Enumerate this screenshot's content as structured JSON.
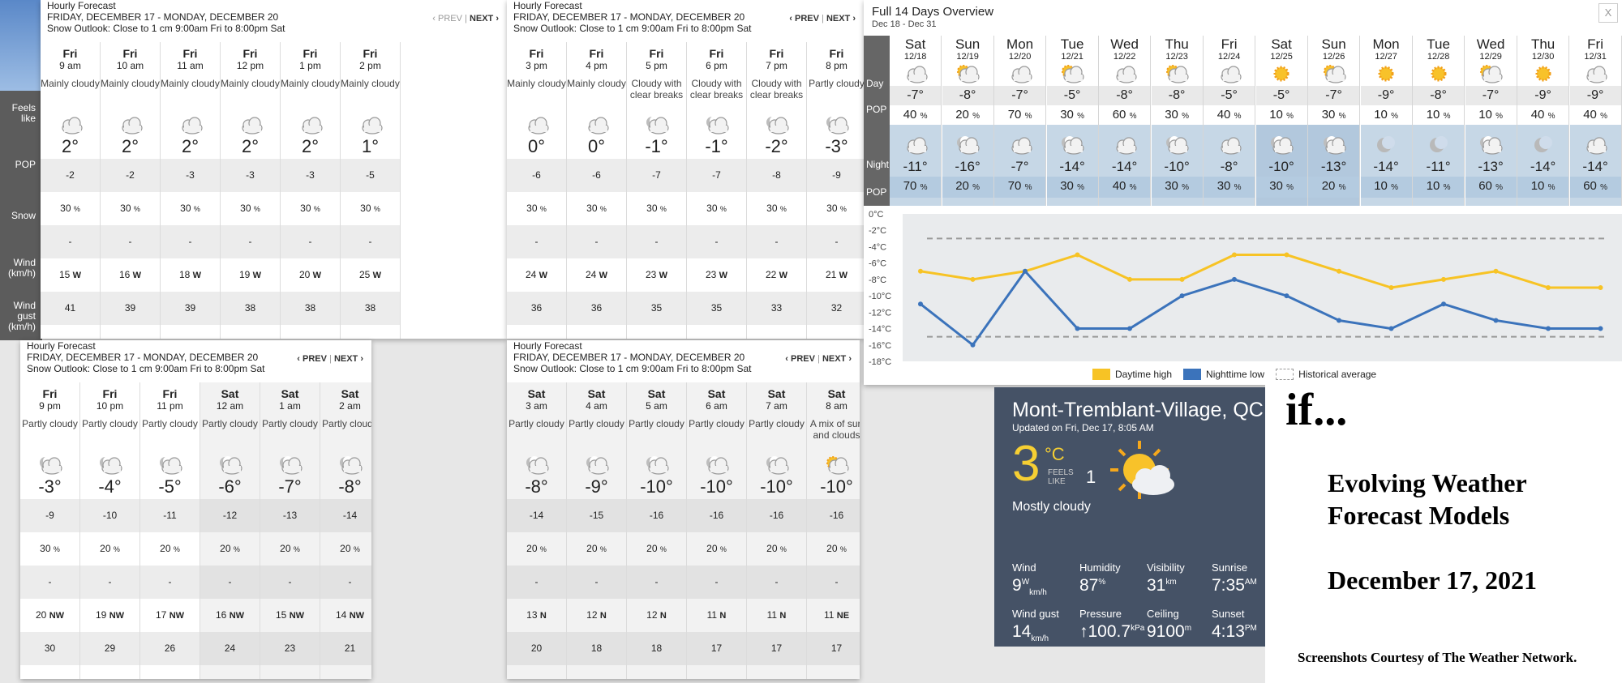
{
  "left_labels": [
    "Feels like",
    "POP",
    "Snow",
    "Wind (km/h)",
    "Wind gust (km/h)"
  ],
  "panels": [
    {
      "heading": "Hourly Forecast",
      "range": "FRIDAY, DECEMBER 17 - MONDAY, DECEMBER 20",
      "outlook": "Snow Outlook: Close to 1 cm 9:00am Fri to 8:00pm Sat",
      "prev": "‹ PREV",
      "sep": "|",
      "next": "NEXT ›",
      "prev_enabled": false,
      "cols": [
        {
          "day": "Fri",
          "time": "9 am",
          "cond": "Mainly cloudy",
          "icon": "cloudy-icon",
          "temp": "2°",
          "feels": "-2",
          "pop": "30",
          "snow": "-",
          "wind": "15",
          "dir": "W",
          "gust": "41",
          "shade": false
        },
        {
          "day": "Fri",
          "time": "10 am",
          "cond": "Mainly cloudy",
          "icon": "cloudy-icon",
          "temp": "2°",
          "feels": "-2",
          "pop": "30",
          "snow": "-",
          "wind": "16",
          "dir": "W",
          "gust": "39",
          "shade": false
        },
        {
          "day": "Fri",
          "time": "11 am",
          "cond": "Mainly cloudy",
          "icon": "cloudy-icon",
          "temp": "2°",
          "feels": "-3",
          "pop": "30",
          "snow": "-",
          "wind": "18",
          "dir": "W",
          "gust": "39",
          "shade": false
        },
        {
          "day": "Fri",
          "time": "12 pm",
          "cond": "Mainly cloudy",
          "icon": "cloudy-icon",
          "temp": "2°",
          "feels": "-3",
          "pop": "30",
          "snow": "-",
          "wind": "19",
          "dir": "W",
          "gust": "38",
          "shade": false
        },
        {
          "day": "Fri",
          "time": "1 pm",
          "cond": "Mainly cloudy",
          "icon": "cloudy-icon",
          "temp": "2°",
          "feels": "-3",
          "pop": "30",
          "snow": "-",
          "wind": "20",
          "dir": "W",
          "gust": "38",
          "shade": false
        },
        {
          "day": "Fri",
          "time": "2 pm",
          "cond": "Mainly cloudy",
          "icon": "cloudy-icon",
          "temp": "1°",
          "feels": "-5",
          "pop": "30",
          "snow": "-",
          "wind": "25",
          "dir": "W",
          "gust": "38",
          "shade": false
        }
      ]
    },
    {
      "heading": "Hourly Forecast",
      "range": "FRIDAY, DECEMBER 17 - MONDAY, DECEMBER 20",
      "outlook": "Snow Outlook: Close to 1 cm 9:00am Fri to 8:00pm Sat",
      "prev": "‹ PREV",
      "sep": "|",
      "next": "NEXT ›",
      "prev_enabled": true,
      "cols": [
        {
          "day": "Fri",
          "time": "3 pm",
          "cond": "Mainly cloudy",
          "icon": "cloudy-icon",
          "temp": "0°",
          "feels": "-6",
          "pop": "30",
          "snow": "-",
          "wind": "24",
          "dir": "W",
          "gust": "36",
          "shade": false
        },
        {
          "day": "Fri",
          "time": "4 pm",
          "cond": "Mainly cloudy",
          "icon": "cloudy-icon",
          "temp": "0°",
          "feels": "-6",
          "pop": "30",
          "snow": "-",
          "wind": "24",
          "dir": "W",
          "gust": "36",
          "shade": false
        },
        {
          "day": "Fri",
          "time": "5 pm",
          "cond": "Cloudy with clear breaks",
          "icon": "cloud-moon-icon",
          "temp": "-1°",
          "feels": "-7",
          "pop": "30",
          "snow": "-",
          "wind": "23",
          "dir": "W",
          "gust": "35",
          "shade": false
        },
        {
          "day": "Fri",
          "time": "6 pm",
          "cond": "Cloudy with clear breaks",
          "icon": "cloud-moon-icon",
          "temp": "-1°",
          "feels": "-7",
          "pop": "30",
          "snow": "-",
          "wind": "23",
          "dir": "W",
          "gust": "35",
          "shade": false
        },
        {
          "day": "Fri",
          "time": "7 pm",
          "cond": "Cloudy with clear breaks",
          "icon": "cloud-moon-icon",
          "temp": "-2°",
          "feels": "-8",
          "pop": "30",
          "snow": "-",
          "wind": "22",
          "dir": "W",
          "gust": "33",
          "shade": false
        },
        {
          "day": "Fri",
          "time": "8 pm",
          "cond": "Partly cloudy",
          "icon": "cloud-moon-icon",
          "temp": "-3°",
          "feels": "-9",
          "pop": "30",
          "snow": "-",
          "wind": "21",
          "dir": "W",
          "gust": "32",
          "shade": false
        }
      ]
    },
    {
      "heading": "Hourly Forecast",
      "range": "FRIDAY, DECEMBER 17 - MONDAY, DECEMBER 20",
      "outlook": "Snow Outlook: Close to 1 cm 9:00am Fri to 8:00pm Sat",
      "prev": "‹ PREV",
      "sep": "|",
      "next": "NEXT ›",
      "prev_enabled": true,
      "cols": [
        {
          "day": "Fri",
          "time": "9 pm",
          "cond": "Partly cloudy",
          "icon": "cloud-moon-icon",
          "temp": "-3°",
          "feels": "-9",
          "pop": "30",
          "snow": "-",
          "wind": "20",
          "dir": "NW",
          "gust": "30",
          "shade": false
        },
        {
          "day": "Fri",
          "time": "10 pm",
          "cond": "Partly cloudy",
          "icon": "cloud-moon-icon",
          "temp": "-4°",
          "feels": "-10",
          "pop": "20",
          "snow": "-",
          "wind": "19",
          "dir": "NW",
          "gust": "29",
          "shade": false
        },
        {
          "day": "Fri",
          "time": "11 pm",
          "cond": "Partly cloudy",
          "icon": "cloud-moon-icon",
          "temp": "-5°",
          "feels": "-11",
          "pop": "20",
          "snow": "-",
          "wind": "17",
          "dir": "NW",
          "gust": "26",
          "shade": false
        },
        {
          "day": "Sat",
          "time": "12 am",
          "cond": "Partly cloudy",
          "icon": "cloud-moon-icon",
          "temp": "-6°",
          "feels": "-12",
          "pop": "20",
          "snow": "-",
          "wind": "16",
          "dir": "NW",
          "gust": "24",
          "shade": true
        },
        {
          "day": "Sat",
          "time": "1 am",
          "cond": "Partly cloudy",
          "icon": "cloud-moon-icon",
          "temp": "-7°",
          "feels": "-13",
          "pop": "20",
          "snow": "-",
          "wind": "15",
          "dir": "NW",
          "gust": "23",
          "shade": true
        },
        {
          "day": "Sat",
          "time": "2 am",
          "cond": "Partly cloudy",
          "icon": "cloud-moon-icon",
          "temp": "-8°",
          "feels": "-14",
          "pop": "20",
          "snow": "-",
          "wind": "14",
          "dir": "NW",
          "gust": "21",
          "shade": true
        }
      ]
    },
    {
      "heading": "Hourly Forecast",
      "range": "FRIDAY, DECEMBER 17 - MONDAY, DECEMBER 20",
      "outlook": "Snow Outlook: Close to 1 cm 9:00am Fri to 8:00pm Sat",
      "prev": "‹ PREV",
      "sep": "|",
      "next": "NEXT ›",
      "prev_enabled": true,
      "cols": [
        {
          "day": "Sat",
          "time": "3 am",
          "cond": "Partly cloudy",
          "icon": "cloud-moon-icon",
          "temp": "-8°",
          "feels": "-14",
          "pop": "20",
          "snow": "-",
          "wind": "13",
          "dir": "N",
          "gust": "20",
          "shade": true
        },
        {
          "day": "Sat",
          "time": "4 am",
          "cond": "Partly cloudy",
          "icon": "cloud-moon-icon",
          "temp": "-9°",
          "feels": "-15",
          "pop": "20",
          "snow": "-",
          "wind": "12",
          "dir": "N",
          "gust": "18",
          "shade": true
        },
        {
          "day": "Sat",
          "time": "5 am",
          "cond": "Partly cloudy",
          "icon": "cloud-moon-icon",
          "temp": "-10°",
          "feels": "-16",
          "pop": "20",
          "snow": "-",
          "wind": "12",
          "dir": "N",
          "gust": "18",
          "shade": true
        },
        {
          "day": "Sat",
          "time": "6 am",
          "cond": "Partly cloudy",
          "icon": "cloud-moon-icon",
          "temp": "-10°",
          "feels": "-16",
          "pop": "20",
          "snow": "-",
          "wind": "11",
          "dir": "N",
          "gust": "17",
          "shade": true
        },
        {
          "day": "Sat",
          "time": "7 am",
          "cond": "Partly cloudy",
          "icon": "cloud-moon-icon",
          "temp": "-10°",
          "feels": "-16",
          "pop": "20",
          "snow": "-",
          "wind": "11",
          "dir": "N",
          "gust": "17",
          "shade": true
        },
        {
          "day": "Sat",
          "time": "8 am",
          "cond": "A mix of sun and clouds",
          "icon": "sun-cloud-icon",
          "temp": "-10°",
          "feels": "-16",
          "pop": "20",
          "snow": "-",
          "wind": "11",
          "dir": "NE",
          "gust": "17",
          "shade": true
        }
      ]
    }
  ],
  "overview": {
    "title": "Full 14 Days Overview",
    "dates": "Dec 18 - Dec 31",
    "close": "X",
    "labels": {
      "day": "Day",
      "pop": "POP",
      "night": "Night"
    },
    "days": [
      {
        "dn": "Sat",
        "dd": "12/18",
        "di": "cloudy-icon",
        "dt": "-7°",
        "dp": "40",
        "ni": "cloudy-icon",
        "nt": "-11°",
        "np": "70"
      },
      {
        "dn": "Sun",
        "dd": "12/19",
        "di": "sun-cloud-icon",
        "dt": "-8°",
        "dp": "20",
        "ni": "cloud-moon-icon",
        "nt": "-16°",
        "np": "20"
      },
      {
        "dn": "Mon",
        "dd": "12/20",
        "di": "cloudy-icon",
        "dt": "-7°",
        "dp": "70",
        "ni": "cloudy-icon",
        "nt": "-7°",
        "np": "70"
      },
      {
        "dn": "Tue",
        "dd": "12/21",
        "di": "sun-cloud-icon",
        "dt": "-5°",
        "dp": "30",
        "ni": "cloud-moon-icon",
        "nt": "-14°",
        "np": "30"
      },
      {
        "dn": "Wed",
        "dd": "12/22",
        "di": "cloudy-icon",
        "dt": "-8°",
        "dp": "60",
        "ni": "cloudy-icon",
        "nt": "-14°",
        "np": "40"
      },
      {
        "dn": "Thu",
        "dd": "12/23",
        "di": "sun-cloud-icon",
        "dt": "-8°",
        "dp": "30",
        "ni": "cloud-moon-icon",
        "nt": "-10°",
        "np": "30"
      },
      {
        "dn": "Fri",
        "dd": "12/24",
        "di": "cloudy-icon",
        "dt": "-5°",
        "dp": "40",
        "ni": "cloudy-icon",
        "nt": "-8°",
        "np": "30"
      },
      {
        "dn": "Sat",
        "dd": "12/25",
        "di": "sun-icon",
        "dt": "-5°",
        "dp": "10",
        "ni": "cloud-moon-icon",
        "nt": "-10°",
        "np": "30"
      },
      {
        "dn": "Sun",
        "dd": "12/26",
        "di": "sun-cloud-icon",
        "dt": "-7°",
        "dp": "30",
        "ni": "cloud-moon-icon",
        "nt": "-13°",
        "np": "20"
      },
      {
        "dn": "Mon",
        "dd": "12/27",
        "di": "sun-icon",
        "dt": "-9°",
        "dp": "10",
        "ni": "moon-icon",
        "nt": "-14°",
        "np": "10"
      },
      {
        "dn": "Tue",
        "dd": "12/28",
        "di": "sun-icon",
        "dt": "-8°",
        "dp": "10",
        "ni": "moon-icon",
        "nt": "-11°",
        "np": "10"
      },
      {
        "dn": "Wed",
        "dd": "12/29",
        "di": "sun-cloud-icon",
        "dt": "-7°",
        "dp": "10",
        "ni": "cloud-moon-icon",
        "nt": "-13°",
        "np": "60"
      },
      {
        "dn": "Thu",
        "dd": "12/30",
        "di": "sun-icon",
        "dt": "-9°",
        "dp": "40",
        "ni": "moon-icon",
        "nt": "-14°",
        "np": "10"
      },
      {
        "dn": "Fri",
        "dd": "12/31",
        "di": "cloudy-icon",
        "dt": "-9°",
        "dp": "40",
        "ni": "cloudy-icon",
        "nt": "-14°",
        "np": "60"
      }
    ]
  },
  "chart_data": {
    "type": "line",
    "categories": [
      "12/18",
      "12/19",
      "12/20",
      "12/21",
      "12/22",
      "12/23",
      "12/24",
      "12/25",
      "12/26",
      "12/27",
      "12/28",
      "12/29",
      "12/30",
      "12/31"
    ],
    "series": [
      {
        "name": "Daytime high",
        "color": "#f7c325",
        "values": [
          -7,
          -8,
          -7,
          -5,
          -8,
          -8,
          -5,
          -5,
          -7,
          -9,
          -8,
          -7,
          -9,
          -9
        ]
      },
      {
        "name": "Nighttime low",
        "color": "#3b73bb",
        "values": [
          -11,
          -16,
          -7,
          -14,
          -14,
          -10,
          -8,
          -10,
          -13,
          -14,
          -11,
          -13,
          -14,
          -14
        ]
      },
      {
        "name": "Historical average",
        "color": "#999999",
        "values": [
          -3,
          -3,
          -3,
          -3,
          -3,
          -3,
          -3,
          -3,
          -3,
          -3,
          -3,
          -3,
          -3,
          -3
        ],
        "values_low": [
          -15,
          -15,
          -15,
          -15,
          -15,
          -15,
          -15,
          -15,
          -15,
          -15,
          -15,
          -15,
          -15,
          -15
        ],
        "dashed": true
      }
    ],
    "yticks": [
      "0°C",
      "-2°C",
      "-4°C",
      "-6°C",
      "-8°C",
      "-10°C",
      "-12°C",
      "-14°C",
      "-16°C",
      "-18°C"
    ],
    "ylim": [
      -18,
      0
    ],
    "grid": false,
    "legend": "bottom"
  },
  "current": {
    "city": "Mont-Tremblant-Village, QC",
    "updated": "Updated on Fri, Dec 17, 8:05 AM",
    "temp": "3",
    "unit": "°C",
    "feels_label": "FEELS LIKE",
    "feels": "1",
    "condition": "Mostly cloudy",
    "stats": [
      {
        "label": "Wind",
        "value": "9",
        "sup": "W",
        "sub": "km/h"
      },
      {
        "label": "Humidity",
        "value": "87",
        "sup": "%",
        "sub": ""
      },
      {
        "label": "Visibility",
        "value": "31",
        "sup": "km",
        "sub": ""
      },
      {
        "label": "Sunrise",
        "value": "7:35",
        "sup": "AM",
        "sub": ""
      },
      {
        "label": "Wind gust",
        "value": "14",
        "sup": "",
        "sub": "km/h"
      },
      {
        "label": "Pressure",
        "value": "↑100.7",
        "sup": "kPa",
        "sub": ""
      },
      {
        "label": "Ceiling",
        "value": "9100",
        "sup": "m",
        "sub": ""
      },
      {
        "label": "Sunset",
        "value": "4:13",
        "sup": "PM",
        "sub": ""
      }
    ]
  },
  "title_card": {
    "if": "if...",
    "l1": "Evolving Weather",
    "l2": "Forecast Models",
    "date": "December 17, 2021",
    "credit": "Screenshots Courtesy of The Weather Network."
  }
}
